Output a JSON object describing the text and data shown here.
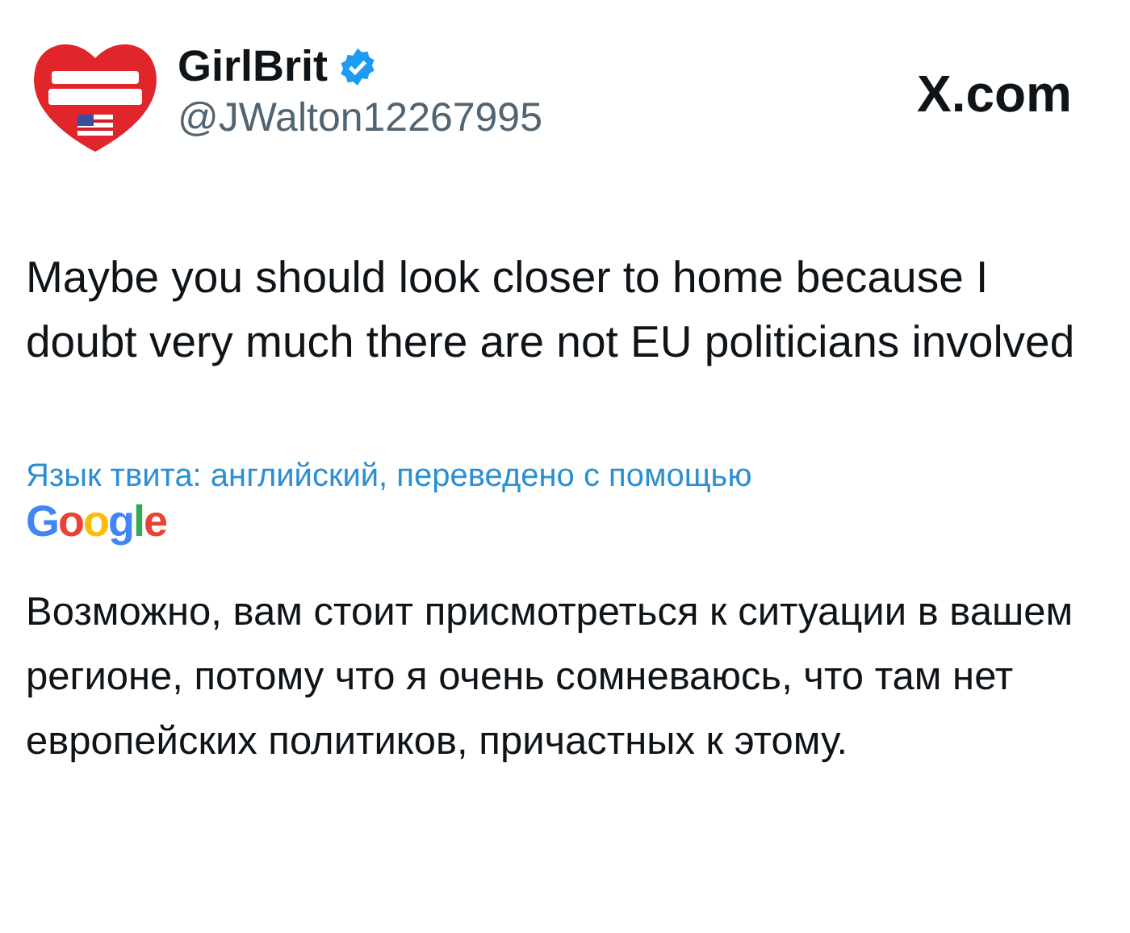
{
  "author": {
    "name": "GirlBrit",
    "verified": true,
    "handle": "@JWalton12267995"
  },
  "site": "X.com",
  "tweet_text": "Maybe you should look closer to home because I doubt very much there are not EU politicians involved",
  "translation": {
    "label": "Язык твита: английский, переведено с помощью",
    "provider": "Google",
    "text": "Возможно, вам стоит присмотреться к ситуации в вашем регионе, потому что я очень сомневаюсь, что там нет европейских политиков, причастных к этому."
  }
}
